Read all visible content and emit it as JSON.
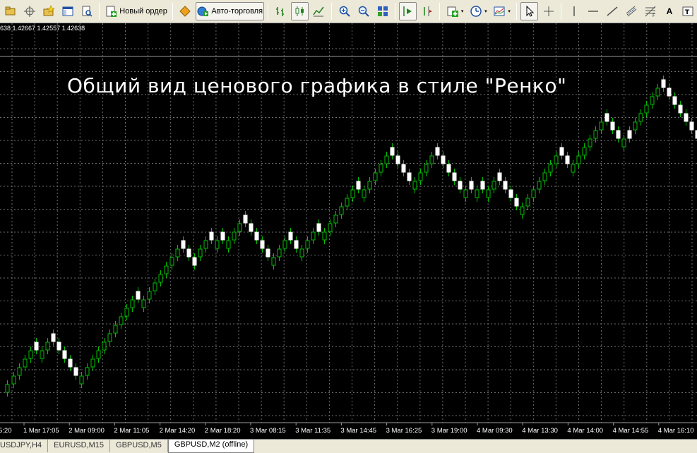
{
  "toolbar": {
    "new_order_label": "Новый ордер",
    "auto_trading_label": "Авто-торговля",
    "text_tool_label": "A"
  },
  "chart": {
    "info_line": "638 1.42667 1.42557 1.42638",
    "overlay_text": "Общий вид ценового графика в стиле \"Ренко\"",
    "time_labels": [
      "5:20",
      "1 Mar 17:05",
      "2 Mar 09:00",
      "2 Mar 11:05",
      "2 Mar 14:20",
      "2 Mar 18:20",
      "3 Mar 08:15",
      "3 Mar 11:35",
      "3 Mar 14:45",
      "3 Mar 16:25",
      "3 Mar 19:00",
      "4 Mar 09:30",
      "4 Mar 13:30",
      "4 Mar 14:00",
      "4 Mar 14:55",
      "4 Mar 16:10"
    ],
    "bull_color": "#00c000",
    "bear_color": "#ffffff",
    "grid_color": "#6f6f6f"
  },
  "tabs": [
    {
      "label": "USDJPY,H4",
      "active": false
    },
    {
      "label": "EURUSD,M15",
      "active": false
    },
    {
      "label": "GBPUSD,M5",
      "active": false
    },
    {
      "label": "GBPUSD,M2 (offline)",
      "active": true
    }
  ]
}
